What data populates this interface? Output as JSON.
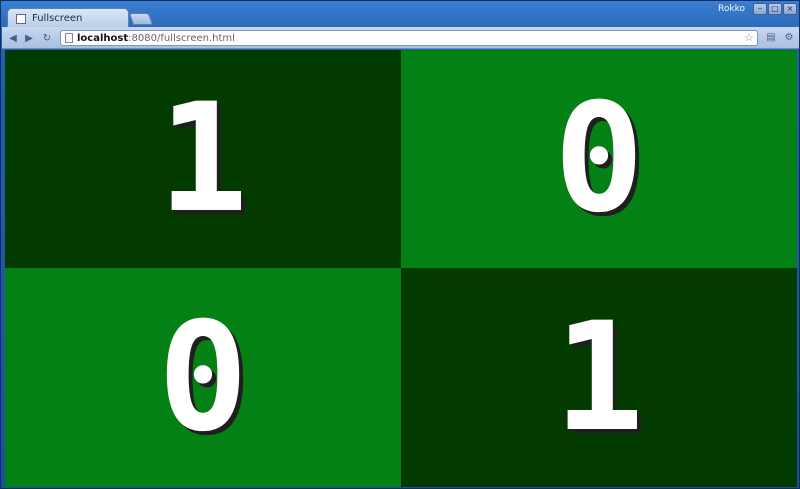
{
  "window": {
    "user_name": "Rokko",
    "buttons": {
      "minimize": "–",
      "maximize": "□",
      "close": "×"
    }
  },
  "tabs": [
    {
      "title": "Fullscreen",
      "active": true
    }
  ],
  "toolbar": {
    "url_host": "localhost",
    "url_rest": ":8080/fullscreen.html"
  },
  "grid": {
    "colors": {
      "dark": "#023a00",
      "light": "#048115"
    },
    "cells": [
      {
        "digit": "1",
        "shade": "dark"
      },
      {
        "digit": "0",
        "shade": "light"
      },
      {
        "digit": "0",
        "shade": "light"
      },
      {
        "digit": "1",
        "shade": "dark"
      }
    ]
  }
}
